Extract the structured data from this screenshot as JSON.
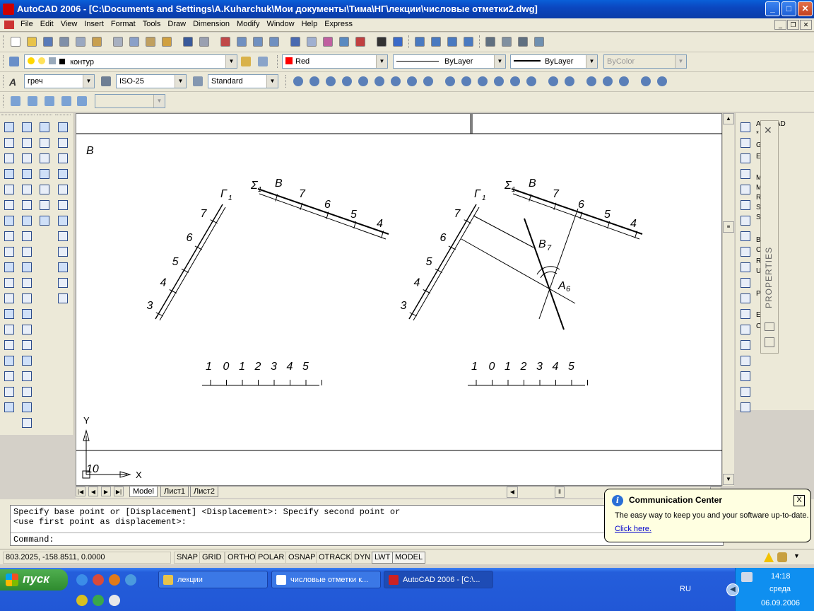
{
  "window": {
    "title": "AutoCAD 2006 - [C:\\Documents and Settings\\A.Kuharchuk\\Мои документы\\Тима\\НГ\\лекции\\числовые отметки2.dwg]",
    "minimize": "_",
    "maximize": "□",
    "close": "✕"
  },
  "menu": [
    "File",
    "Edit",
    "View",
    "Insert",
    "Format",
    "Tools",
    "Draw",
    "Dimension",
    "Modify",
    "Window",
    "Help",
    "Express"
  ],
  "layers": {
    "layer_name": "контур",
    "color": "Red",
    "color_swatch": "#ff0000",
    "linetype": "ByLayer",
    "lineweight": "ByLayer",
    "plotstyle": "ByColor"
  },
  "styles": {
    "text_style": "греч",
    "dim_style": "ISO-25",
    "table_style": "Standard"
  },
  "drawing": {
    "label_b_top": "В",
    "left": {
      "gamma_label": "Г",
      "gamma_sub": "1",
      "gamma_ticks": [
        "7",
        "6",
        "5",
        "4",
        "3"
      ],
      "sigma_label": "Σ",
      "sigma_sub": "1",
      "sigma_ticks": [
        "В",
        "7",
        "6",
        "5",
        "4"
      ],
      "scale": [
        "1",
        "0",
        "1",
        "2",
        "3",
        "4",
        "5"
      ]
    },
    "right": {
      "gamma_label": "Г",
      "gamma_sub": "1",
      "gamma_ticks": [
        "7",
        "6",
        "5",
        "4",
        "3"
      ],
      "sigma_label": "Σ",
      "sigma_sub": "1",
      "sigma_ticks": [
        "В",
        "7",
        "6",
        "5",
        "4"
      ],
      "b7_label": "В",
      "b7_sub": "7",
      "a6_label": "А",
      "a6_sub": "6",
      "scale": [
        "1",
        "0",
        "1",
        "2",
        "3",
        "4",
        "5"
      ]
    },
    "ucs": {
      "y": "Y",
      "x": "X",
      "ten": "10"
    }
  },
  "tabs": [
    "Model",
    "Лист1",
    "Лист2"
  ],
  "command": {
    "line1": "Specify base point or [Displacement] <Displacement>: Specify second point or",
    "line2": "<use first point as displacement>:",
    "prompt": "Command:"
  },
  "status": {
    "coords": "803.2025, -158.8511, 0.0000",
    "buttons": [
      {
        "label": "SNAP",
        "on": false
      },
      {
        "label": "GRID",
        "on": false
      },
      {
        "label": "ORTHO",
        "on": false
      },
      {
        "label": "POLAR",
        "on": false
      },
      {
        "label": "OSNAP",
        "on": false
      },
      {
        "label": "OTRACK",
        "on": false
      },
      {
        "label": "DYN",
        "on": false
      },
      {
        "label": "LWT",
        "on": true
      },
      {
        "label": "MODEL",
        "on": true
      }
    ]
  },
  "balloon": {
    "title": "Communication Center",
    "message": "The easy way to keep you and your software up-to-date.",
    "link": "Click here.",
    "close": "X"
  },
  "properties_panel": {
    "title": "PROPERTIES",
    "close": "✕",
    "peek_lines": [
      "AutoCAD",
      "*",
      "G",
      "E",
      "M",
      "M",
      "R",
      "S",
      "S",
      "B",
      "C",
      "R",
      "U",
      "P",
      "E",
      "C"
    ]
  },
  "taskbar": {
    "start": "пуск",
    "buttons": [
      {
        "label": "лекции",
        "icon": "folder-icon",
        "color": "#e8c34a",
        "active": false
      },
      {
        "label": "числовые отметки к...",
        "icon": "word-icon",
        "color": "#ffffff",
        "active": false
      },
      {
        "label": "AutoCAD 2006 - [C:\\...",
        "icon": "autocad-icon",
        "color": "#cc2222",
        "active": true
      }
    ],
    "lang": "RU",
    "time": "14:18",
    "day": "среда",
    "date": "06.09.2006"
  }
}
